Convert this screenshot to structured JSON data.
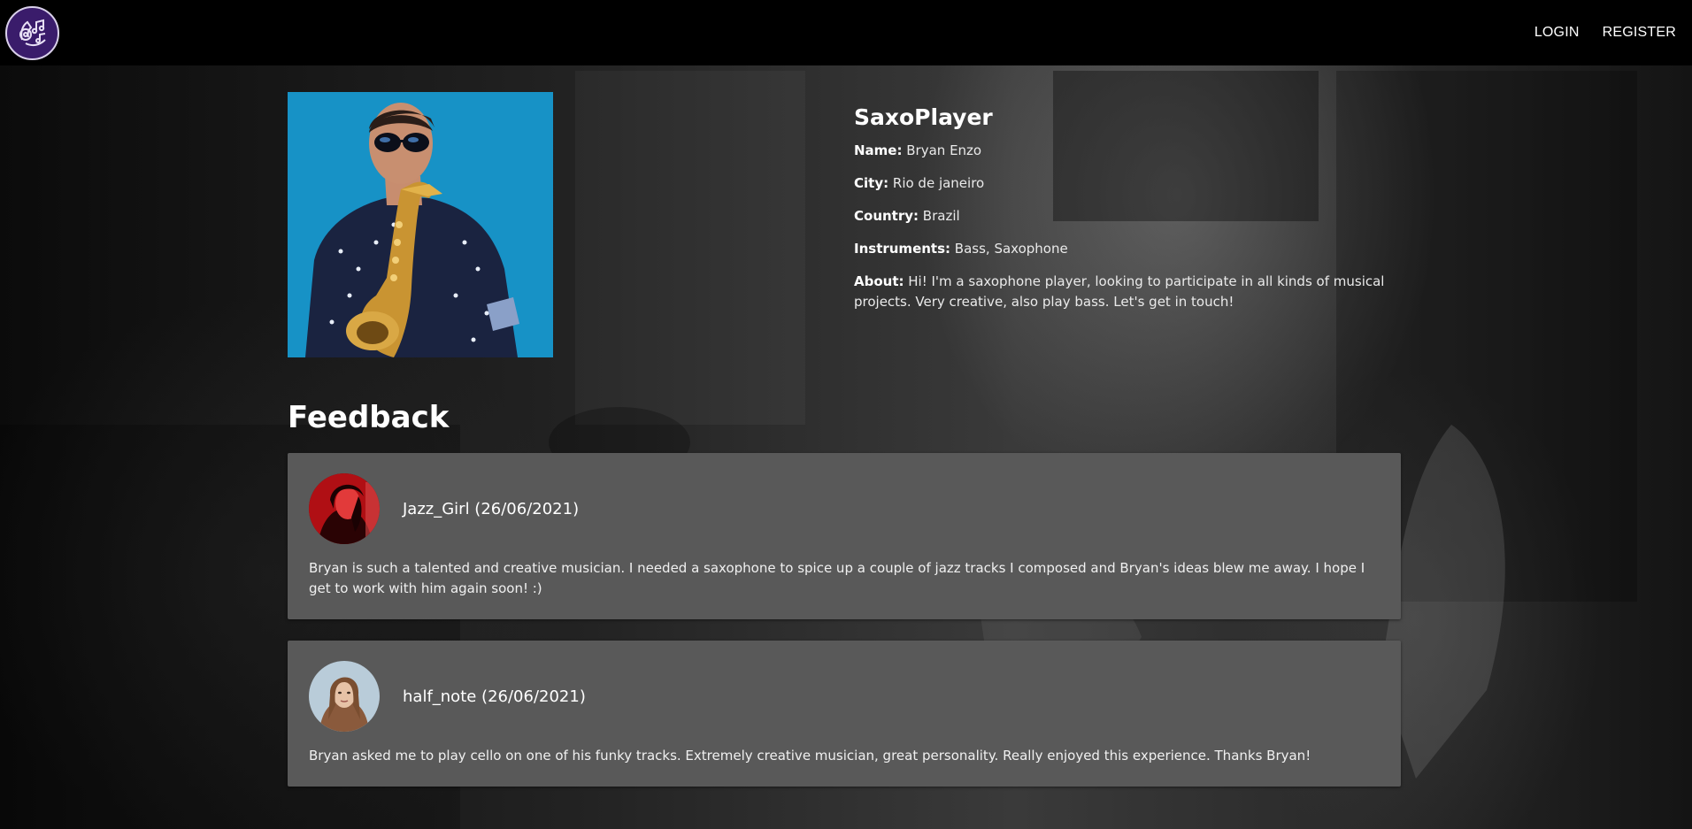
{
  "nav": {
    "logo_icon": "music-note-hand-icon",
    "links": [
      "LOGIN",
      "REGISTER"
    ]
  },
  "profile": {
    "username": "SaxoPlayer",
    "fields": [
      {
        "label": "Name:",
        "value": "Bryan Enzo"
      },
      {
        "label": "City:",
        "value": "Rio de janeiro"
      },
      {
        "label": "Country:",
        "value": "Brazil"
      },
      {
        "label": "Instruments:",
        "value": "Bass, Saxophone"
      },
      {
        "label": "About:",
        "value": "Hi! I'm a saxophone player, looking to participate in all kinds of musical projects. Very creative, also play bass. Let's get in touch!"
      }
    ]
  },
  "feedback": {
    "title": "Feedback",
    "items": [
      {
        "author": "Jazz_Girl (26/06/2021)",
        "text": "Bryan is such a talented and creative musician. I needed a saxophone to spice up a couple of jazz tracks I composed and Bryan's ideas blew me away. I hope I get to work with him again soon! :)"
      },
      {
        "author": "half_note (26/06/2021)",
        "text": "Bryan asked me to play cello on one of his funky tracks. Extremely creative musician, great personality. Really enjoyed this experience. Thanks Bryan!"
      }
    ]
  },
  "colors": {
    "navbar": "#000000",
    "logo_bg": "#3a1c6b",
    "card_bg": "#595959",
    "photo_bg": "#1aa0d6"
  }
}
